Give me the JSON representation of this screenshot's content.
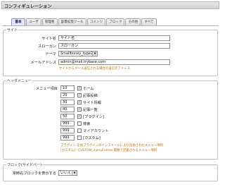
{
  "title": "コンフィギュレーション",
  "tabs": [
    "基本",
    "ユーザ",
    "管理者",
    "容量拡張ツール",
    "コメンツ",
    "ブロック",
    "その他",
    "すべて"
  ],
  "site_section": {
    "legend": "サイト",
    "site_name": {
      "label": "サイト名",
      "value": "サイト名"
    },
    "slogan": {
      "label": "スローガン",
      "value": "スローガン"
    },
    "theme": {
      "label": "テーマ",
      "value": "Smallboney_type2"
    },
    "email": {
      "label": "メールアドレス",
      "value": "admin@mail.trybase.com",
      "hint": "サイトからメール送信される場合の送信元アドレス"
    }
  },
  "header_menu": {
    "legend": "ヘッダメニュー",
    "order_label": "メニュー項目",
    "items": [
      {
        "order": "10",
        "checked": true,
        "label": "ホーム"
      },
      {
        "order": "20",
        "checked": true,
        "label": "記事投稿"
      },
      {
        "order": "30",
        "checked": true,
        "label": "サイト情報"
      },
      {
        "order": "40",
        "checked": true,
        "label": "記事一覧"
      },
      {
        "order": "50",
        "checked": true,
        "label": "[プラグイン]"
      },
      {
        "order": "999",
        "checked": false,
        "label": "検索"
      },
      {
        "order": "999",
        "checked": false,
        "label": "マイアカウント"
      },
      {
        "order": "999",
        "checked": false,
        "label": "[カスタム]"
      }
    ],
    "note_line1": "プラグイン を他プラグインのインストールにより追加されたメニュー項目",
    "note_line2": "[カスタム] : CUSTOM_menuEntries 関数で定義されるメニュー項目"
  },
  "block_section": {
    "legend": "ブロック(サイドバー)",
    "label": "常時右ブロックを表示する",
    "value": "いいえ"
  }
}
